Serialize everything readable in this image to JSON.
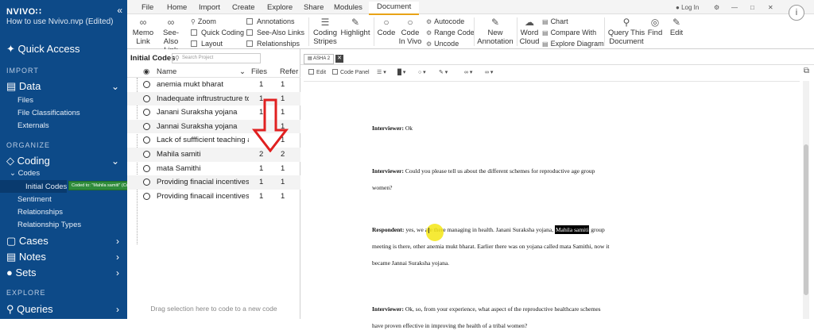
{
  "app": {
    "logo": "NVIVO∷",
    "project": "How to use Nvivo.nvp (Edited)",
    "collapse_icon": "«"
  },
  "sidebar": {
    "quick_access": "Quick Access",
    "import_header": "IMPORT",
    "data": "Data",
    "data_items": [
      "Files",
      "File Classifications",
      "Externals"
    ],
    "organize_header": "ORGANIZE",
    "coding": "Coding",
    "codes": "Codes",
    "initial_codes": "Initial Codes",
    "coding_items": [
      "Sentiment",
      "Relationships",
      "Relationship Types"
    ],
    "cases": "Cases",
    "notes": "Notes",
    "sets": "Sets",
    "explore_header": "EXPLORE",
    "queries": "Queries",
    "tooltip": "Coded to: \"Mahila samiti\" (Codes\\\\Initial Codes)"
  },
  "ribbon": {
    "tabs": [
      "File",
      "Home",
      "Import",
      "Create",
      "Explore",
      "Share",
      "Modules",
      "Document"
    ],
    "active_tab": "Document",
    "login": "Log In",
    "info": "i",
    "buttons": {
      "memo_link": [
        "Memo",
        "Link"
      ],
      "see_also_link": [
        "See-Also",
        "Link"
      ],
      "zoom": "Zoom",
      "quick_coding": "Quick Coding",
      "layout": "Layout",
      "annotations": "Annotations",
      "see_also_links": "See-Also Links",
      "relationships": "Relationships",
      "coding_stripes": [
        "Coding",
        "Stripes"
      ],
      "highlight": "Highlight",
      "code": "Code",
      "code_in_vivo": [
        "Code",
        "In Vivo"
      ],
      "autocode": "Autocode",
      "range_code": "Range Code",
      "uncode": "Uncode",
      "new_annotation": [
        "New",
        "Annotation"
      ],
      "word_cloud": [
        "Word",
        "Cloud"
      ],
      "chart": "Chart",
      "compare_with": "Compare With",
      "explore_diagram": "Explore Diagram",
      "query_this_document": [
        "Query This",
        "Document"
      ],
      "find": "Find",
      "edit": "Edit"
    }
  },
  "codes_panel": {
    "title": "Initial Codes",
    "search_placeholder": "Search Project",
    "columns": {
      "name": "Name",
      "files": "Files",
      "refs": "Refer"
    },
    "rows": [
      {
        "name": "anemia mukt bharat",
        "files": "1",
        "refs": "1"
      },
      {
        "name": "Inadequate inftrustructure to c",
        "files": "1",
        "refs": "1"
      },
      {
        "name": "Janani Suraksha yojana",
        "files": "1",
        "refs": "1"
      },
      {
        "name": "Jannai Suraksha yojana",
        "files": "",
        "refs": "1"
      },
      {
        "name": "Lack of suffficient  teaching aid",
        "files": "",
        "refs": "1"
      },
      {
        "name": "Mahila samiti",
        "files": "2",
        "refs": "2"
      },
      {
        "name": "mata Samithi",
        "files": "1",
        "refs": "1"
      },
      {
        "name": "Providing  finacial incentives fo",
        "files": "1",
        "refs": "1"
      },
      {
        "name": "Providing finacail incentives to",
        "files": "1",
        "refs": "1"
      }
    ],
    "footer": "Drag selection here to code to a new code"
  },
  "document": {
    "tab_label": "ASHA 2",
    "toolbar": {
      "edit": "Edit",
      "code_panel": "Code Panel"
    },
    "paragraphs": {
      "p1_speaker": "Interviewer:",
      "p1_text": " Ok",
      "p2_speaker": "Interviewer:",
      "p2_text": " Could you please tell us about the different schemes for reproductive age group women?",
      "p3_speaker": "Respondent:",
      "p3_text_a": " yes, we are there managing in health. Janani Suraksha yojana, ",
      "p3_highlight": "Mahila samiti",
      "p3_text_b": " group meeting is there, other anemia mukt bharat. Earlier there was on yojana called mata Samithi, now it became Jannai Suraksha yojana.",
      "p4_speaker": "Interviewer:",
      "p4_text": " Ok, so, from your experience, what aspect of the reproductive healthcare schemes have proven effective in improving the health of a tribal women?"
    }
  },
  "colors": {
    "sidebar_bg": "#0d4a88",
    "active_tab_underline": "#e8a316",
    "annotation_arrow": "#e02020",
    "tooltip_bg": "#2e8b3a",
    "cursor_highlight": "#f5e614"
  }
}
